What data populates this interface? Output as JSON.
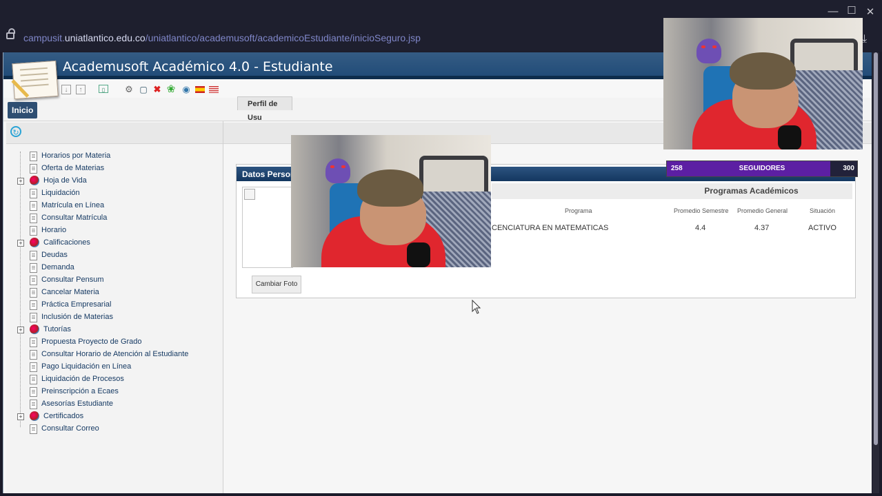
{
  "browser": {
    "url_prefix": "campusit.",
    "url_domain": "uniatlantico.edu.co",
    "url_path": "/uniatlantico/academusoft/academicoEstudiante/inicioSeguro.jsp",
    "minimize_icon": "minimize-icon",
    "maximize_icon": "maximize-icon",
    "close_icon": "close-icon"
  },
  "app": {
    "title": "Academusoft Académico 4.0 - Estudiante",
    "menu_home": "Inicio"
  },
  "sidebar": {
    "items": [
      {
        "label": "Horarios por Materia",
        "type": "doc"
      },
      {
        "label": "Oferta de Materias",
        "type": "doc"
      },
      {
        "label": "Hoja de Vida",
        "type": "folder"
      },
      {
        "label": "Liquidación",
        "type": "doc"
      },
      {
        "label": "Matrícula en Línea",
        "type": "doc"
      },
      {
        "label": "Consultar Matrícula",
        "type": "doc"
      },
      {
        "label": "Horario",
        "type": "doc"
      },
      {
        "label": "Calificaciones",
        "type": "folder"
      },
      {
        "label": "Deudas",
        "type": "doc"
      },
      {
        "label": "Demanda",
        "type": "doc"
      },
      {
        "label": "Consultar Pensum",
        "type": "doc"
      },
      {
        "label": "Cancelar Materia",
        "type": "doc"
      },
      {
        "label": "Práctica Empresarial",
        "type": "doc"
      },
      {
        "label": "Inclusión de Materias",
        "type": "doc"
      },
      {
        "label": "Tutorías",
        "type": "folder"
      },
      {
        "label": "Propuesta Proyecto de Grado",
        "type": "doc"
      },
      {
        "label": "Consultar Horario de Atención al Estudiante",
        "type": "doc"
      },
      {
        "label": "Pago Liquidación en Línea",
        "type": "doc"
      },
      {
        "label": "Liquidación de Procesos",
        "type": "doc"
      },
      {
        "label": "Preinscripción a Ecaes",
        "type": "doc"
      },
      {
        "label": "Asesorías Estudiante",
        "type": "doc"
      },
      {
        "label": "Certificados",
        "type": "folder"
      },
      {
        "label": "Consultar Correo",
        "type": "doc"
      }
    ]
  },
  "main": {
    "tab_label": "Perfil de Usu",
    "panel_title": "Datos Persona",
    "change_photo_button": "Cambiar Foto",
    "programs": {
      "title": "Programas Académicos",
      "columns": [
        "Programa",
        "Promedio Semestre",
        "Promedio General",
        "Situación"
      ],
      "row": {
        "program": "CENCIATURA EN MATEMATICAS",
        "semester_avg": "4.4",
        "general_avg": "4.37",
        "status": "ACTIVO"
      }
    }
  },
  "stream": {
    "followers_current": "258",
    "followers_label": "SEGUIDORES",
    "followers_goal": "300",
    "followers_progress": 0.86,
    "accent": "#5c1fa3"
  }
}
